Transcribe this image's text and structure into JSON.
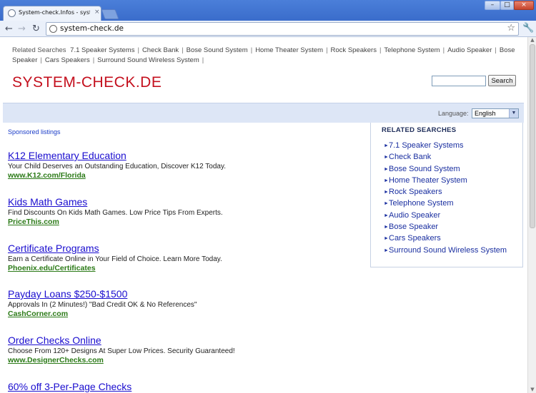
{
  "browser": {
    "tab_title": "System-check.Infos - system-c",
    "tab_close": "×",
    "url": "system-check.de",
    "window_buttons": {
      "minimize": "–",
      "maximize": "□",
      "close": "×"
    }
  },
  "top_related": {
    "label": "Related Searches",
    "terms": [
      "7.1 Speaker Systems",
      "Check Bank",
      "Bose Sound System",
      "Home Theater System",
      "Rock Speakers",
      "Telephone System",
      "Audio Speaker",
      "Bose Speaker",
      "Cars Speakers",
      "Surround Sound Wireless System"
    ]
  },
  "site": {
    "title": "SYSTEM-CHECK.DE",
    "search_button": "Search",
    "search_value": ""
  },
  "language": {
    "label": "Language:",
    "selected": "English"
  },
  "sponsored_label": "Sponsored listings",
  "ads": [
    {
      "title": "K12 Elementary Education",
      "desc": "Your Child Deserves an Outstanding Education, Discover K12 Today.",
      "url": "www.K12.com/Florida"
    },
    {
      "title": "Kids Math Games",
      "desc": "Find Discounts On Kids Math Games. Low Price Tips From Experts.",
      "url": "PriceThis.com"
    },
    {
      "title": "Certificate Programs",
      "desc": "Earn a Certificate Online in Your Field of Choice. Learn More Today.",
      "url": "Phoenix.edu/Certificates"
    },
    {
      "title": "Payday Loans $250-$1500",
      "desc": "Approvals In (2 Minutes!) \"Bad Credit OK & No References\"",
      "url": "CashCorner.com"
    },
    {
      "title": "Order Checks Online",
      "desc": "Choose From 120+ Designs At Super Low Prices. Security Guaranteed!",
      "url": "www.DesignerChecks.com"
    },
    {
      "title": "60% off 3-Per-Page Checks",
      "desc": "",
      "url": ""
    }
  ],
  "related_panel": {
    "title": "RELATED SEARCHES",
    "items": [
      "7.1 Speaker Systems",
      "Check Bank",
      "Bose Sound System",
      "Home Theater System",
      "Rock Speakers",
      "Telephone System",
      "Audio Speaker",
      "Bose Speaker",
      "Cars Speakers",
      "Surround Sound Wireless System"
    ]
  }
}
